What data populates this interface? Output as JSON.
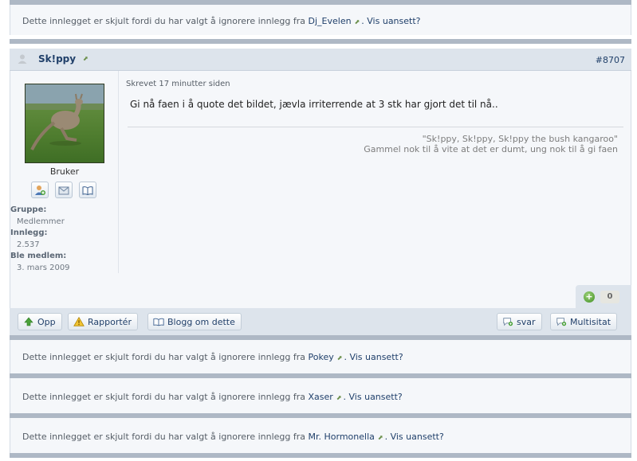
{
  "ignored_template": {
    "prefix": "Dette innlegget er skjult fordi du har valgt å ignorere innlegg fra",
    "show_link": ". Vis uansett?"
  },
  "ignored_posts": [
    {
      "user": "Dj_Evelen"
    },
    {
      "user": "Pokey"
    },
    {
      "user": "Xaser"
    },
    {
      "user": "Mr. Hormonella"
    }
  ],
  "post": {
    "author": "Sk!ppy",
    "post_number": "#8707",
    "time": "Skrevet 17 minutter siden",
    "text": "Gi nå faen i å quote det bildet, jævla irriterrende at 3 stk har gjort det til nå..",
    "signature_line1": "\"Sk!ppy, Sk!ppy, Sk!ppy the bush kangaroo\"",
    "signature_line2": "Gammel nok til å vite at det er dumt, ung nok til å gi faen",
    "reputation": "0"
  },
  "author_info": {
    "title": "Bruker",
    "group_label": "Gruppe:",
    "group_value": "Medlemmer",
    "posts_label": "Innlegg:",
    "posts_value": "2.537",
    "joined_label": "Ble medlem:",
    "joined_value": "3. mars 2009"
  },
  "controls": {
    "up": "Opp",
    "report": "Rapportér",
    "blog": "Blogg om dette",
    "reply": "svar",
    "multiquote": "Multisitat"
  },
  "colors": {
    "link": "#1f3f6a",
    "header_bg": "#dde4ec",
    "separator": "#aeb8c5",
    "post_bg": "#f5f7fa"
  }
}
